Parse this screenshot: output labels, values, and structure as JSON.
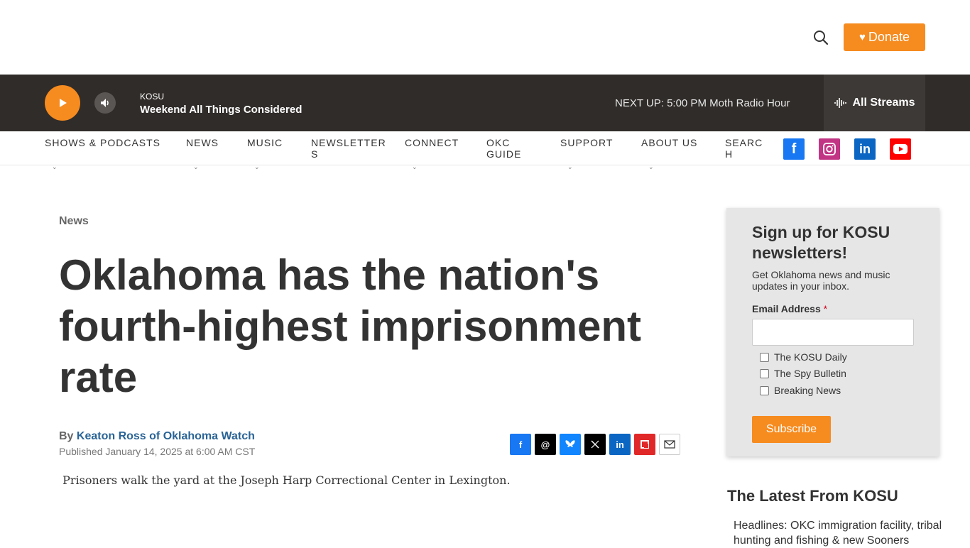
{
  "header": {
    "donate_label": "Donate"
  },
  "player": {
    "station": "KOSU",
    "program": "Weekend All Things Considered",
    "next_up": "NEXT UP: 5:00 PM Moth Radio Hour",
    "streams_label": "All Streams"
  },
  "nav": {
    "items": [
      {
        "label": "SHOWS & PODCASTS"
      },
      {
        "label": "NEWS"
      },
      {
        "label": "MUSIC"
      },
      {
        "label": "NEWSLETTER S"
      },
      {
        "label": "CONNECT"
      },
      {
        "label": "OKC GUIDE"
      },
      {
        "label": "SUPPORT"
      },
      {
        "label": "ABOUT US"
      },
      {
        "label": "SEARC H"
      }
    ]
  },
  "article": {
    "category": "News",
    "headline": "Oklahoma has the nation's fourth-highest imprisonment rate",
    "by_prefix": "By",
    "author": "Keaton Ross of Oklahoma Watch",
    "published": "Published January 14, 2025 at 6:00 AM CST",
    "image_alt": "Prisoners walk the yard at the Joseph Harp Correctional Center in Lexington."
  },
  "newsletter": {
    "title": "Sign up for KOSU newsletters!",
    "description": "Get Oklahoma news and music updates in your inbox.",
    "email_label": "Email Address",
    "required_mark": "*",
    "options": [
      "The KOSU Daily",
      "The Spy Bulletin",
      "Breaking News"
    ],
    "submit_label": "Subscribe"
  },
  "latest": {
    "title": "The Latest From KOSU",
    "first_item": "Headlines: OKC immigration facility, tribal hunting and fishing & new Sooners"
  },
  "colors": {
    "accent": "#f68b1f",
    "player_bg": "#302c29",
    "link": "#2a6496"
  }
}
